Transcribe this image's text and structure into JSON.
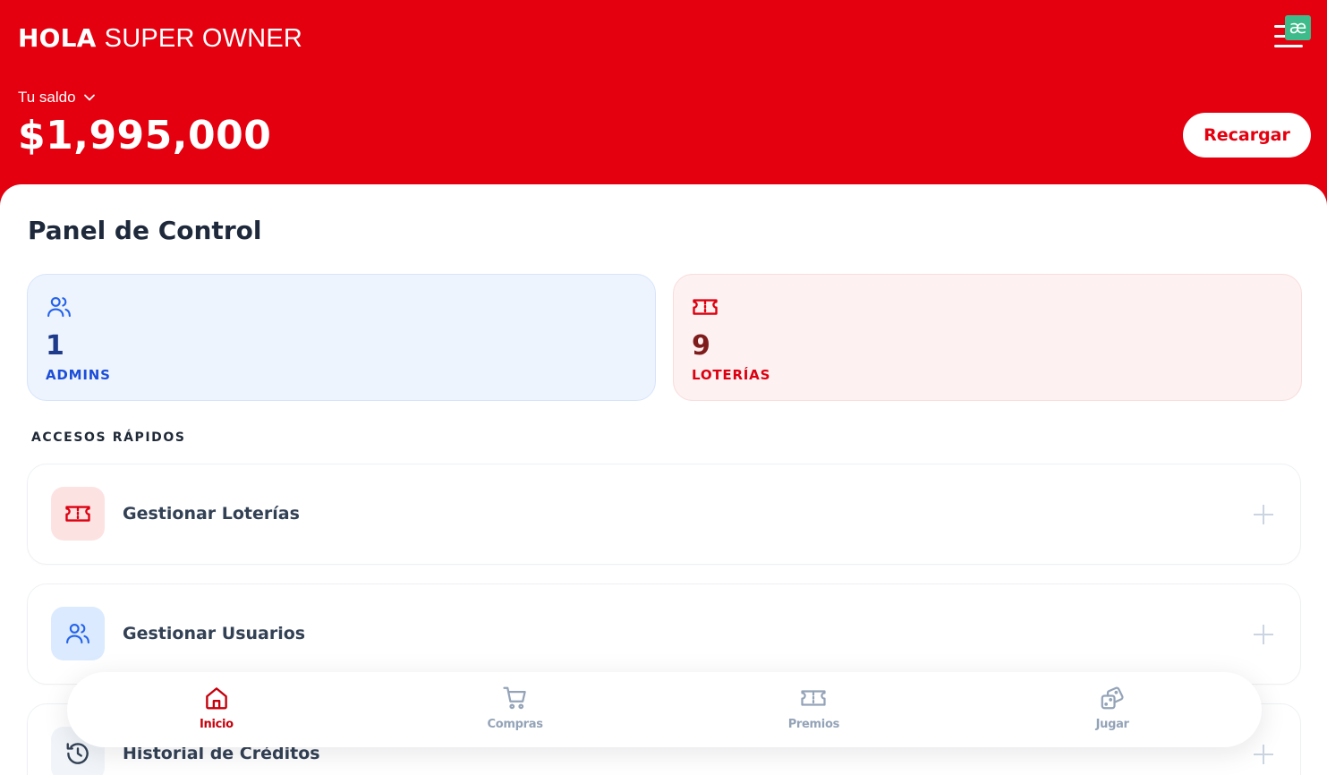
{
  "header": {
    "greeting_strong": "HOLA",
    "greeting_rest": "SUPER OWNER",
    "balance_label": "Tu saldo",
    "balance_value": "$1,995,000",
    "recharge_label": "Recargar",
    "extension_glyph": "æ"
  },
  "panel": {
    "title": "Panel de Control",
    "stats": [
      {
        "value": "1",
        "label": "ADMINS",
        "icon": "users-icon"
      },
      {
        "value": "9",
        "label": "LOTERÍAS",
        "icon": "ticket-icon"
      }
    ]
  },
  "quick_access": {
    "title": "ACCESOS RÁPIDOS",
    "items": [
      {
        "label": "Gestionar Loterías",
        "icon": "ticket-icon"
      },
      {
        "label": "Gestionar Usuarios",
        "icon": "users-icon"
      },
      {
        "label": "Historial de Créditos",
        "icon": "history-icon"
      }
    ]
  },
  "bottom_nav": {
    "items": [
      {
        "label": "Inicio",
        "icon": "home-icon",
        "active": true
      },
      {
        "label": "Compras",
        "icon": "cart-icon",
        "active": false
      },
      {
        "label": "Premios",
        "icon": "ticket-icon",
        "active": false
      },
      {
        "label": "Jugar",
        "icon": "dice-icon",
        "active": false
      }
    ]
  },
  "colors": {
    "brand_red": "#e4000f",
    "blue_accent": "#1d4ed8",
    "muted_gray": "#94a3b8"
  }
}
